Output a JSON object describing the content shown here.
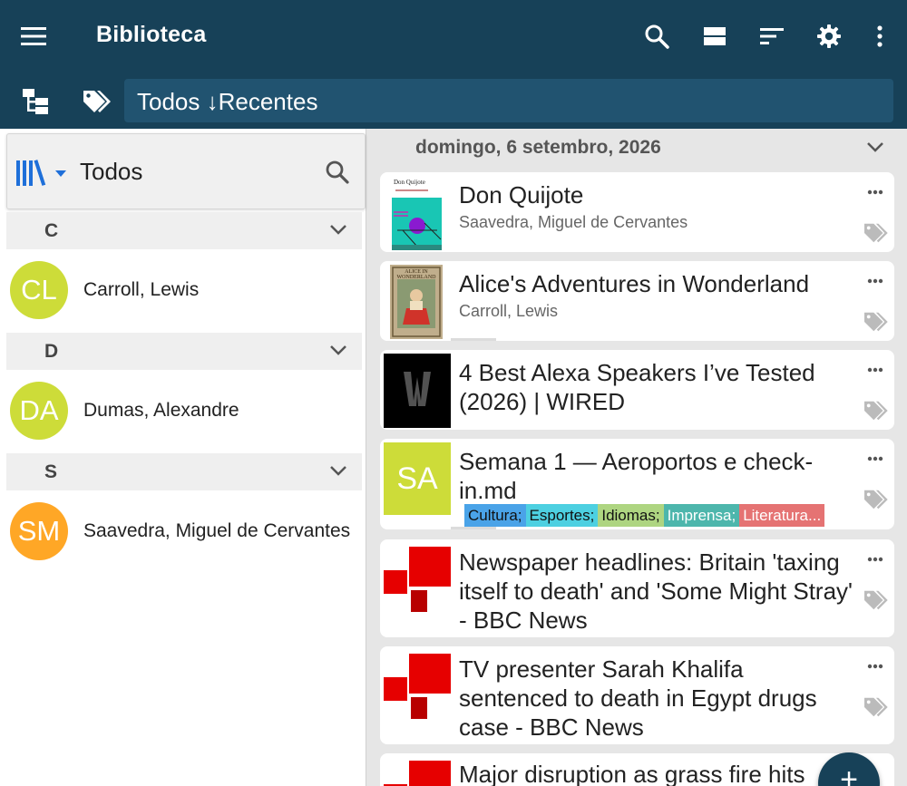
{
  "appbar": {
    "title": "Biblioteca",
    "filter_text": "Todos ↓Recentes"
  },
  "library": {
    "title": "Todos",
    "groups": [
      {
        "letter": "C",
        "author": {
          "initials": "CL",
          "name": "Carroll, Lewis",
          "color": "#cddc39"
        }
      },
      {
        "letter": "D",
        "author": {
          "initials": "DA",
          "name": "Dumas, Alexandre",
          "color": "#cddc39"
        }
      },
      {
        "letter": "S",
        "author": {
          "initials": "SM",
          "name": "Saavedra, Miguel de Cervantes",
          "color": "#ffa726"
        }
      }
    ]
  },
  "feed": {
    "date": "domingo, 6 setembro, 2026",
    "items": [
      {
        "title": "Don Quijote",
        "subtitle": "Saavedra, Miguel de Cervantes",
        "cover_title": "Don Quijote"
      },
      {
        "title": "Alice's Adventures in Wonderland",
        "subtitle": "Carroll, Lewis",
        "cover_title": "ALICE IN WONDERLAND"
      },
      {
        "title": "4 Best Alexa Speakers I’ve Tested (2026) | WIRED"
      },
      {
        "title": "Semana 1 — Aeroportos e check-in.md",
        "thumb_initials": "SA",
        "tags": [
          {
            "label": "Cultura;",
            "color": "#4aa3e8"
          },
          {
            "label": "Esportes;",
            "color": "#4dd0e1"
          },
          {
            "label": "Idiomas;",
            "color": "#aed581"
          },
          {
            "label": "Imprensa;",
            "color": "#4db6ac"
          },
          {
            "label": "Literatura...",
            "color": "#e57373"
          }
        ]
      },
      {
        "title": "Newspaper headlines: Britain 'taxing itself to death' and 'Some Might Stray' - BBC News"
      },
      {
        "title": "TV presenter Sarah Khalifa sentenced to death in Egypt drugs case - BBC News"
      },
      {
        "title": "Major disruption as grass fire hits"
      }
    ]
  },
  "fab": {
    "label": "+"
  },
  "icons": {
    "menu": "menu-icon",
    "search": "search-icon",
    "view": "view-mode-icon",
    "sort": "sort-icon",
    "settings": "gear-icon",
    "more": "more-vert-icon",
    "tree": "tree-icon",
    "tag": "tag-icon",
    "library": "library-icon",
    "chevron": "chevron-down-icon",
    "dots": "more-horiz-icon"
  },
  "colors": {
    "appbar": "#174158",
    "filterbox": "#215370",
    "accent": "#1e6fd9",
    "bbc_red": "#e60000"
  }
}
